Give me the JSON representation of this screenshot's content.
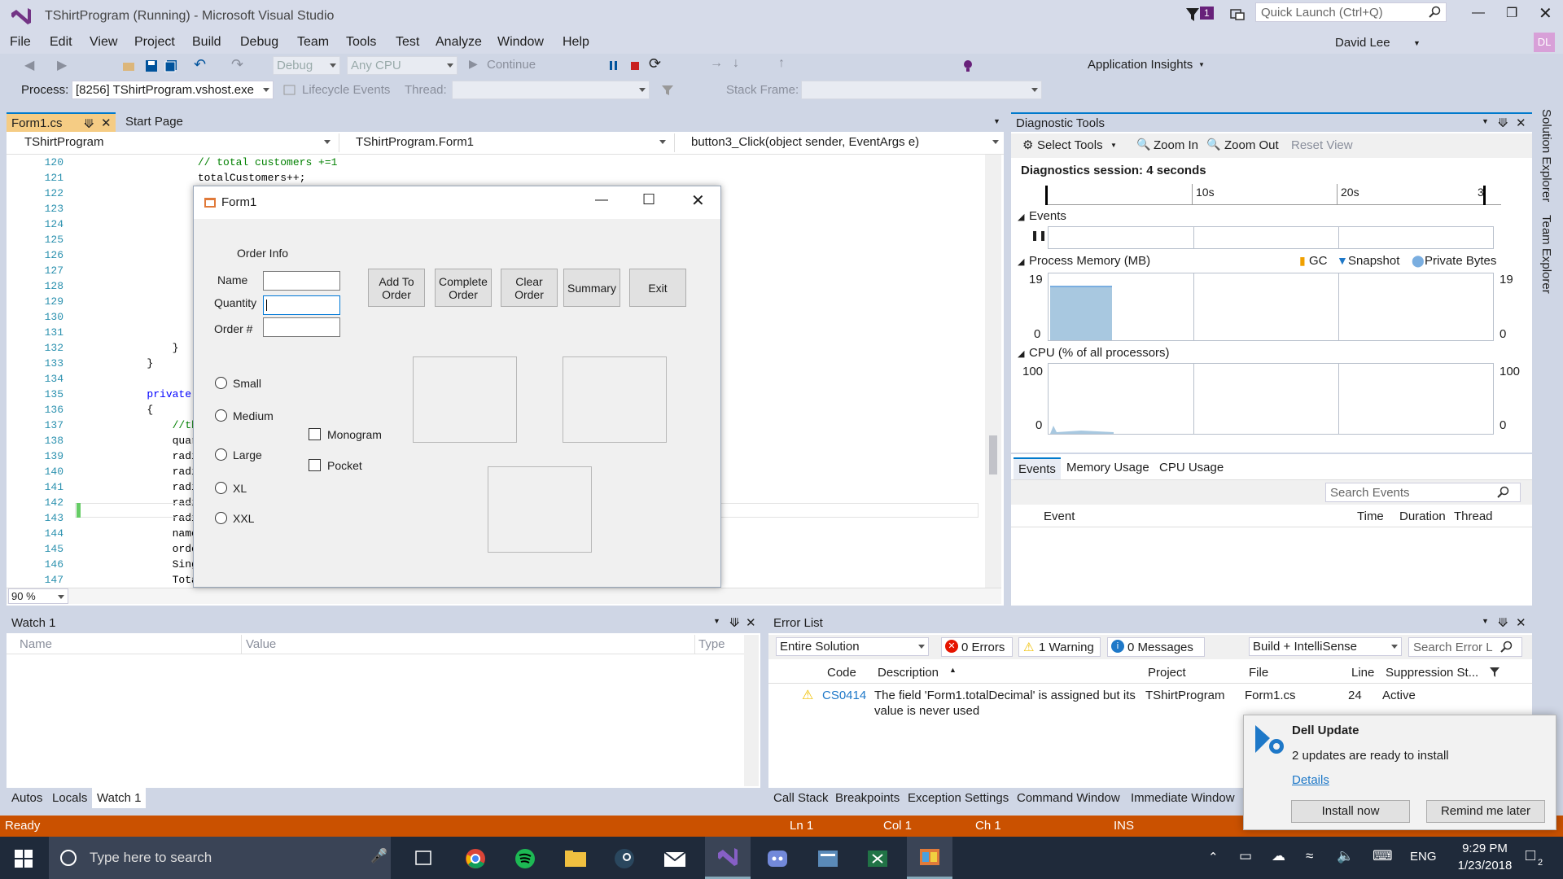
{
  "app": {
    "title": "TShirtProgram (Running) - Microsoft Visual Studio",
    "quick_launch_placeholder": "Quick Launch (Ctrl+Q)",
    "notif_count": "1",
    "user": "David Lee",
    "user_initials": "DL"
  },
  "menu": [
    "File",
    "Edit",
    "View",
    "Project",
    "Build",
    "Debug",
    "Team",
    "Tools",
    "Test",
    "Analyze",
    "Window",
    "Help"
  ],
  "toolbar": {
    "config": "Debug",
    "platform": "Any CPU",
    "continue": "Continue",
    "app_insights": "Application Insights"
  },
  "toolbar2": {
    "process_label": "Process:",
    "process_value": "[8256] TShirtProgram.vshost.exe",
    "lifecycle": "Lifecycle Events",
    "thread_label": "Thread:",
    "stackframe_label": "Stack Frame:"
  },
  "doc_tabs": {
    "active": "Form1.cs",
    "other": "Start Page"
  },
  "editor": {
    "project_combo": "TShirtProgram",
    "class_combo": "TShirtProgram.Form1",
    "member_combo": "button3_Click(object sender, EventArgs e)",
    "zoom": "90 %",
    "lines": [
      {
        "n": "120",
        "code": "                // total customers +=1",
        "kind": "comment"
      },
      {
        "n": "121",
        "code": "                totalCustomers++;",
        "kind": "code"
      },
      {
        "n": "122",
        "code": "",
        "kind": "code"
      },
      {
        "n": "123",
        "code": "",
        "kind": "code"
      },
      {
        "n": "124",
        "code": "",
        "kind": "code"
      },
      {
        "n": "125",
        "code": "",
        "kind": "code"
      },
      {
        "n": "126",
        "code": "",
        "kind": "code"
      },
      {
        "n": "127",
        "code": "",
        "kind": "code"
      },
      {
        "n": "128",
        "code": "",
        "kind": "code"
      },
      {
        "n": "129",
        "code": "",
        "kind": "code"
      },
      {
        "n": "130",
        "code": "",
        "kind": "code"
      },
      {
        "n": "131",
        "code": "",
        "kind": "code"
      },
      {
        "n": "132",
        "code": "            }",
        "kind": "code"
      },
      {
        "n": "133",
        "code": "        }",
        "kind": "code"
      },
      {
        "n": "134",
        "code": "",
        "kind": "code"
      },
      {
        "n": "135",
        "code": "        private",
        "kind": "keyword"
      },
      {
        "n": "136",
        "code": "        {",
        "kind": "code"
      },
      {
        "n": "137",
        "code": "            //th",
        "kind": "comment"
      },
      {
        "n": "138",
        "code": "            quar",
        "kind": "code"
      },
      {
        "n": "139",
        "code": "            radi",
        "kind": "code"
      },
      {
        "n": "140",
        "code": "            radi",
        "kind": "code"
      },
      {
        "n": "141",
        "code": "            radi",
        "kind": "code"
      },
      {
        "n": "142",
        "code": "            radi",
        "kind": "code"
      },
      {
        "n": "143",
        "code": "            radi",
        "kind": "code"
      },
      {
        "n": "144",
        "code": "            name",
        "kind": "code"
      },
      {
        "n": "145",
        "code": "            orde",
        "kind": "code"
      },
      {
        "n": "146",
        "code": "            Sing",
        "kind": "code"
      },
      {
        "n": "147",
        "code": "            Tota",
        "kind": "code"
      }
    ]
  },
  "form1": {
    "title": "Form1",
    "group_label": "Order Info",
    "name_label": "Name",
    "quantity_label": "Quantity",
    "order_label": "Order #",
    "buttons": [
      "Add To\nOrder",
      "Complete\nOrder",
      "Clear\nOrder",
      "Summary",
      "Exit"
    ],
    "sizes": [
      "Small",
      "Medium",
      "Large",
      "XL",
      "XXL"
    ],
    "options": [
      "Monogram",
      "Pocket"
    ]
  },
  "diag": {
    "title": "Diagnostic Tools",
    "select_tools": "Select Tools",
    "zoom_in": "Zoom In",
    "zoom_out": "Zoom Out",
    "reset_view": "Reset View",
    "session": "Diagnostics session: 4 seconds",
    "ticks": [
      "10s",
      "20s",
      "3"
    ],
    "events_label": "Events",
    "memory_label": "Process Memory (MB)",
    "legend": [
      "GC",
      "Snapshot",
      "Private Bytes"
    ],
    "mem_max": "19",
    "mem_min": "0",
    "cpu_label": "CPU (% of all processors)",
    "cpu_max": "100",
    "cpu_min": "0",
    "tabs": [
      "Events",
      "Memory Usage",
      "CPU Usage"
    ],
    "search_placeholder": "Search Events",
    "columns": [
      "Event",
      "Time",
      "Duration",
      "Thread"
    ],
    "memory_level": 0.84
  },
  "watch": {
    "title": "Watch 1",
    "columns": [
      "Name",
      "Value",
      "Type"
    ],
    "tabs": [
      "Autos",
      "Locals",
      "Watch 1"
    ]
  },
  "errlist": {
    "title": "Error List",
    "scope": "Entire Solution",
    "errors": "0 Errors",
    "warnings": "1 Warning",
    "messages": "0 Messages",
    "build": "Build + IntelliSense",
    "search_placeholder": "Search Error L",
    "columns": [
      "Code",
      "Description",
      "Project",
      "File",
      "Line",
      "Suppression St..."
    ],
    "row": {
      "code": "CS0414",
      "desc1": "The field 'Form1.totalDecimal' is assigned but its",
      "desc2": "value is never used",
      "project": "TShirtProgram",
      "file": "Form1.cs",
      "line": "24",
      "supp": "Active"
    },
    "tabs": [
      "Call Stack",
      "Breakpoints",
      "Exception Settings",
      "Command Window",
      "Immediate Window"
    ]
  },
  "side_tabs": [
    "Solution Explorer",
    "Team Explorer"
  ],
  "status": {
    "ready": "Ready",
    "ln": "Ln 1",
    "col": "Col 1",
    "ch": "Ch 1",
    "ins": "INS"
  },
  "taskbar": {
    "search": "Type here to search",
    "time": "9:29 PM",
    "date": "1/23/2018",
    "lang": "ENG",
    "notif": "2"
  },
  "toast": {
    "title": "Dell Update",
    "body": "2 updates are ready to install",
    "link": "Details",
    "install": "Install now",
    "remind": "Remind me later"
  },
  "colors": {
    "accent": "#007acc",
    "status": "#ca5100",
    "chrome": "#d6dbe9",
    "memory_fill": "#a8c8e0"
  }
}
